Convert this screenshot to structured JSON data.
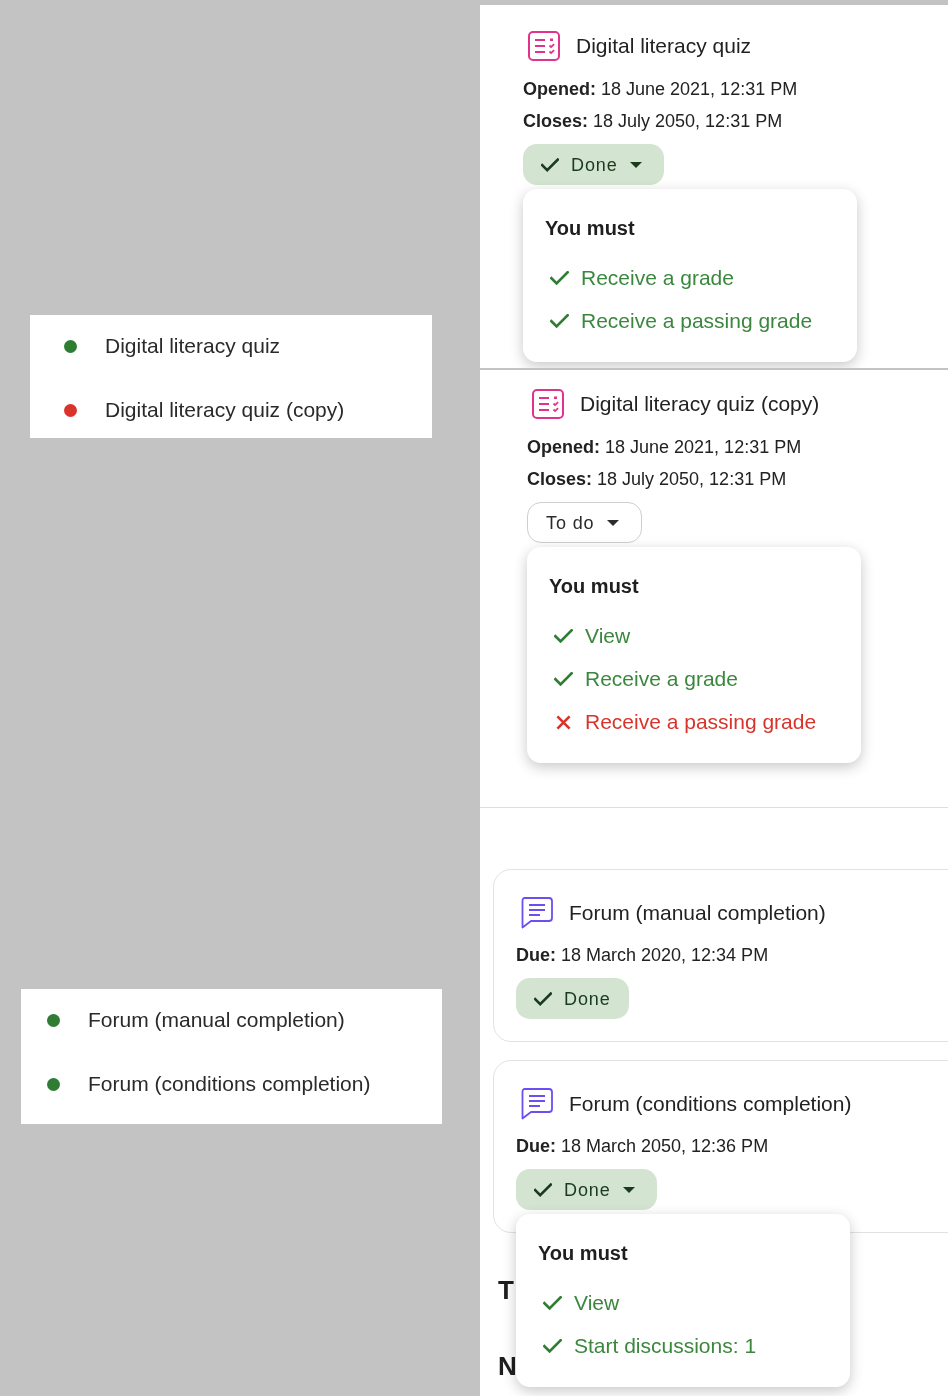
{
  "legends": [
    {
      "items": [
        {
          "label": "Digital literacy quiz",
          "color": "#2e7d32"
        },
        {
          "label": "Digital literacy quiz (copy)",
          "color": "#d9342b"
        }
      ]
    },
    {
      "items": [
        {
          "label": "Forum (manual completion)",
          "color": "#2e7d32"
        },
        {
          "label": "Forum (conditions completion)",
          "color": "#2e7d32"
        }
      ]
    }
  ],
  "panels": [
    {
      "kind": "plain",
      "activities": [
        {
          "kind": "quiz",
          "title": "Digital literacy quiz",
          "dates": [
            "**Opened:** 18 June 2021, 12:31 PM",
            "**Closes:** 18 July 2050, 12:31 PM"
          ],
          "completion": {
            "label": "Done",
            "done": true,
            "dropdown": true
          },
          "popup": {
            "heading": "You must",
            "conditions": [
              {
                "label": "Receive a grade",
                "met": true
              },
              {
                "label": "Receive a passing grade",
                "met": true
              }
            ]
          }
        }
      ]
    },
    {
      "kind": "plain",
      "activities": [
        {
          "kind": "quiz",
          "title": "Digital literacy quiz (copy)",
          "dates": [
            "**Opened:** 18 June 2021, 12:31 PM",
            "**Closes:** 18 July 2050, 12:31 PM"
          ],
          "completion": {
            "label": "To do",
            "done": false,
            "dropdown": true
          },
          "popup": {
            "heading": "You must",
            "conditions": [
              {
                "label": "View",
                "met": true
              },
              {
                "label": "Receive a grade",
                "met": true
              },
              {
                "label": "Receive a passing grade",
                "met": false
              }
            ]
          }
        }
      ]
    },
    {
      "kind": "cards",
      "activities": [
        {
          "kind": "forum",
          "title": "Forum (manual completion)",
          "dates": [
            "**Due:** 18 March 2020, 12:34 PM"
          ],
          "completion": {
            "label": "Done",
            "done": true,
            "dropdown": false
          }
        },
        {
          "kind": "forum",
          "title": "Forum (conditions completion)",
          "dates": [
            "**Due:** 18 March 2050, 12:36 PM"
          ],
          "completion": {
            "label": "Done",
            "done": true,
            "dropdown": true
          },
          "popup": {
            "heading": "You must",
            "conditions": [
              {
                "label": "View",
                "met": true
              },
              {
                "label": "Start discussions: 1",
                "met": true
              }
            ]
          }
        }
      ],
      "cut_off_headings": [
        "T",
        "N"
      ]
    }
  ]
}
